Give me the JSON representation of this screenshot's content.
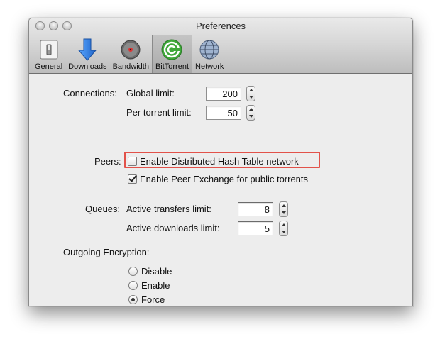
{
  "window": {
    "title": "Preferences"
  },
  "toolbar": {
    "items": [
      {
        "label": "General",
        "icon": "general-switch-icon"
      },
      {
        "label": "Downloads",
        "icon": "download-arrow-icon"
      },
      {
        "label": "Bandwidth",
        "icon": "disk-gauge-icon"
      },
      {
        "label": "BitTorrent",
        "icon": "bittorrent-logo-icon"
      },
      {
        "label": "Network",
        "icon": "network-globe-icon"
      }
    ],
    "selected": "BitTorrent"
  },
  "connections": {
    "section_label": "Connections:",
    "global_label": "Global limit:",
    "global_value": "200",
    "per_torrent_label": "Per torrent limit:",
    "per_torrent_value": "50"
  },
  "peers": {
    "section_label": "Peers:",
    "dht_label": "Enable Distributed Hash Table network",
    "dht_checked": false,
    "pex_label": "Enable Peer Exchange for public torrents",
    "pex_checked": true
  },
  "queues": {
    "section_label": "Queues:",
    "transfers_label": "Active transfers limit:",
    "transfers_value": "8",
    "downloads_label": "Active downloads limit:",
    "downloads_value": "5"
  },
  "encryption": {
    "section_label": "Outgoing Encryption:",
    "options": [
      "Disable",
      "Enable",
      "Force"
    ],
    "selected": "Force"
  },
  "colors": {
    "highlight": "#e2524a",
    "bittorrent_green": "#3fa83a",
    "downloads_blue": "#2f7fe0"
  }
}
